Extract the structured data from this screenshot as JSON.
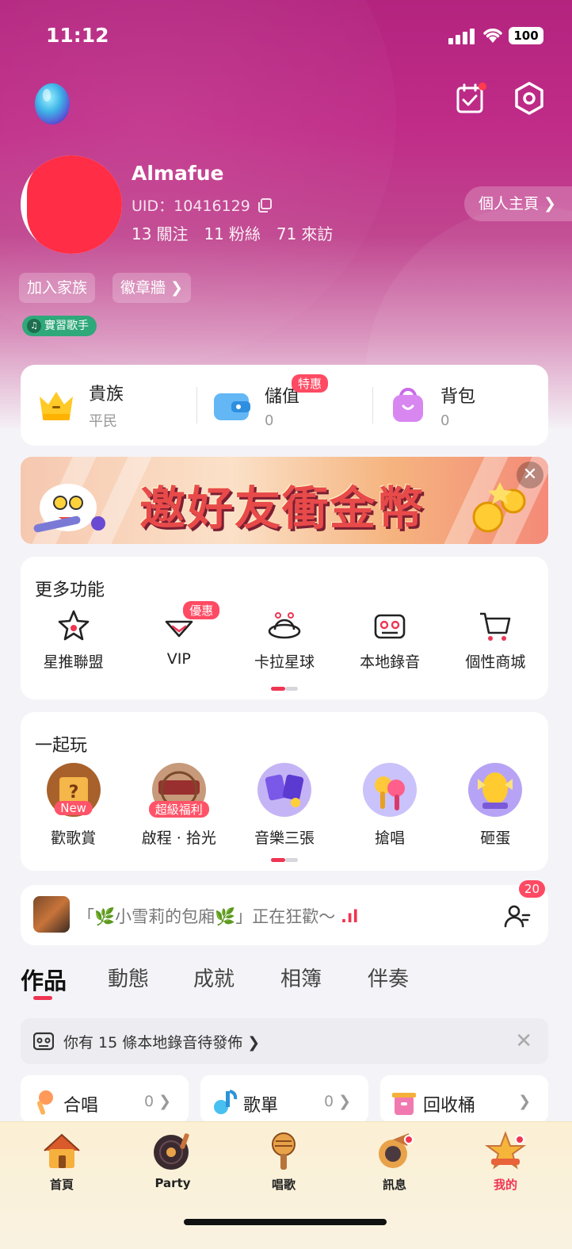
{
  "status": {
    "time": "11:12",
    "battery": "100"
  },
  "profile": {
    "username": "Almafue",
    "uid": "UID：10416129",
    "following_count": "13",
    "following_label": "關注",
    "fans_count": "11",
    "fans_label": "粉絲",
    "visits_count": "71",
    "visits_label": "來訪",
    "homepage_button": "個人主頁 ❯",
    "join_family": "加入家族",
    "badge_wall": "徽章牆 ❯",
    "singer_level": "實習歌手"
  },
  "wallet": {
    "items": [
      {
        "title": "貴族",
        "sub": "平民",
        "icon": "crown-icon"
      },
      {
        "title": "儲值",
        "sub": "0",
        "tag": "特惠",
        "icon": "wallet-icon"
      },
      {
        "title": "背包",
        "sub": "0",
        "icon": "backpack-icon"
      }
    ]
  },
  "banner": {
    "text": "邀好友衝金幣",
    "close": "✕"
  },
  "more_functions": {
    "title": "更多功能",
    "items": [
      {
        "label": "星推聯盟",
        "icon": "star-alliance-icon"
      },
      {
        "label": "VIP",
        "tag": "優惠",
        "icon": "vip-heart-icon"
      },
      {
        "label": "卡拉星球",
        "icon": "karaoke-planet-icon"
      },
      {
        "label": "本地錄音",
        "icon": "local-recording-icon"
      },
      {
        "label": "個性商城",
        "icon": "shopping-cart-icon"
      }
    ]
  },
  "play_together": {
    "title": "一起玩",
    "items": [
      {
        "label": "歡歌賞",
        "tag": "New",
        "icon": "song-reward-icon"
      },
      {
        "label": "啟程 · 拾光",
        "tag": "超級福利",
        "icon": "anniversary-icon"
      },
      {
        "label": "音樂三張",
        "icon": "music-cards-icon"
      },
      {
        "label": "搶唱",
        "icon": "grab-sing-icon"
      },
      {
        "label": "砸蛋",
        "icon": "smash-egg-icon"
      }
    ]
  },
  "party": {
    "text_prefix": "「",
    "room_name": "小雪莉的包廂",
    "text_suffix": "」正在狂歡～",
    "leaf": "🌿",
    "bars": ".ıl",
    "follow_count": "20"
  },
  "tabs": [
    "作品",
    "動態",
    "成就",
    "相簿",
    "伴奏"
  ],
  "notice": {
    "text": "你有 15 條本地錄音待發佈 ❯",
    "close": "✕"
  },
  "collections": [
    {
      "label": "合唱",
      "count": "0 ❯",
      "icon": "chorus-icon"
    },
    {
      "label": "歌單",
      "count": "0 ❯",
      "icon": "playlist-icon"
    },
    {
      "label": "回收桶",
      "count": "❯",
      "icon": "recycle-bin-icon"
    }
  ],
  "bottom_nav": [
    {
      "label": "首頁",
      "icon": "home-icon"
    },
    {
      "label": "Party",
      "icon": "party-record-icon"
    },
    {
      "label": "唱歌",
      "icon": "microphone-icon"
    },
    {
      "label": "訊息",
      "icon": "message-icon"
    },
    {
      "label": "我的",
      "icon": "profile-star-icon"
    }
  ],
  "colors": {
    "accent": "#ef3553",
    "hero": "#b3247f",
    "badge_green": "#2fa87a"
  }
}
